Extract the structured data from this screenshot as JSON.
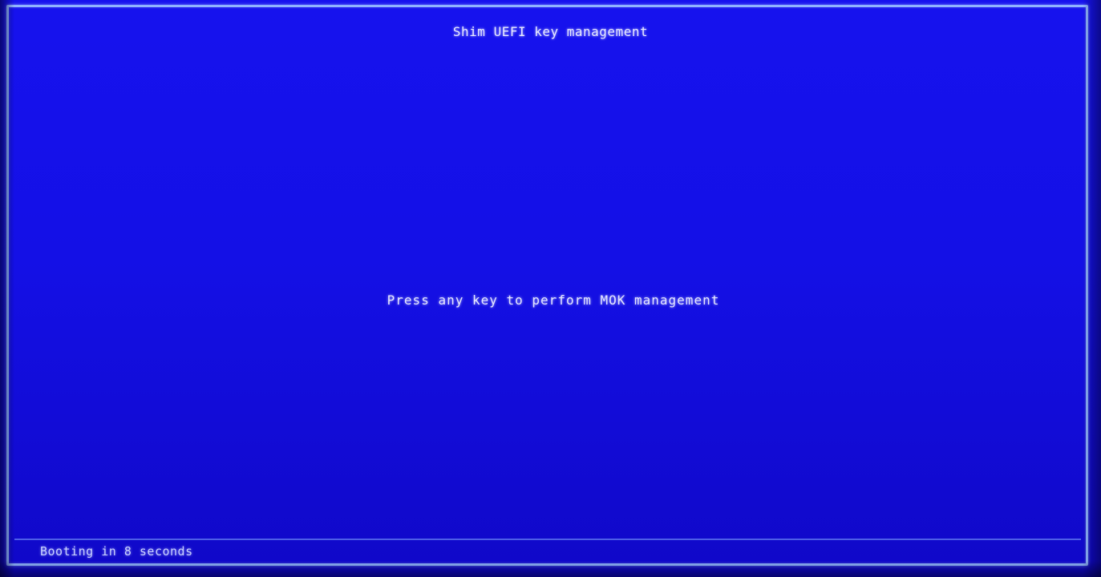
{
  "screen": {
    "title": "Shim UEFI key management",
    "prompt": "Press any key to perform MOK management",
    "status": "Booting in 8 seconds"
  },
  "colors": {
    "background": "#1612ee",
    "border": "#8fb4ff",
    "text": "#e8eaff"
  }
}
